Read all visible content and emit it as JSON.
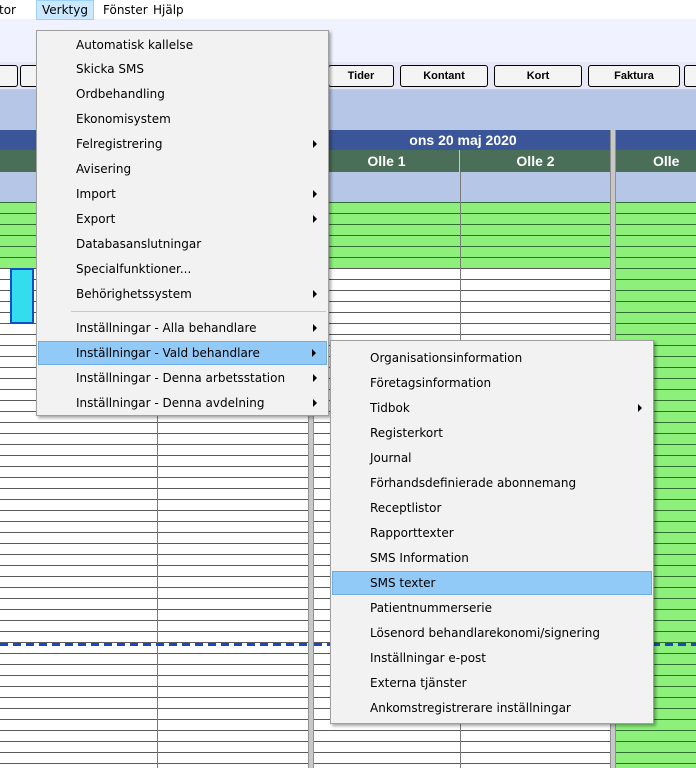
{
  "menubar": {
    "items": [
      {
        "label": "tor"
      },
      {
        "label": "Verktyg"
      },
      {
        "label": "Fönster"
      },
      {
        "label": "Hjälp"
      }
    ]
  },
  "toolbar": {
    "buttons": [
      {
        "label": ""
      },
      {
        "label": ""
      },
      {
        "label": "Tider"
      },
      {
        "label": "Kontant"
      },
      {
        "label": "Kort"
      },
      {
        "label": "Faktura"
      },
      {
        "label": ""
      }
    ]
  },
  "calendar": {
    "day1": {
      "date": "ons 20 maj 2020",
      "resources": [
        "Olle 1",
        "Olle 2"
      ]
    },
    "day2": {
      "date": "",
      "resources": [
        "Olle"
      ]
    },
    "colors": {
      "free_slot": "#8cf07a",
      "header": "#3a5698",
      "resource_header": "#4a6e58",
      "now_line": "#1848c8",
      "selected_booking": "#33ddee"
    }
  },
  "verktyg_menu": {
    "items": [
      {
        "label": "Automatisk kallelse"
      },
      {
        "label": "Skicka SMS"
      },
      {
        "label": "Ordbehandling"
      },
      {
        "label": "Ekonomisystem"
      },
      {
        "label": "Felregistrering"
      },
      {
        "label": "Avisering"
      },
      {
        "label": "Import"
      },
      {
        "label": "Export"
      },
      {
        "label": "Databasanslutningar"
      },
      {
        "label": "Specialfunktioner..."
      },
      {
        "label": "Behörighetssystem"
      },
      {
        "label": "Inställningar - Alla behandlare"
      },
      {
        "label": "Inställningar - Vald behandlare"
      },
      {
        "label": "Inställningar - Denna arbetsstation"
      },
      {
        "label": "Inställningar - Denna avdelning"
      }
    ],
    "highlighted": "Inställningar - Vald behandlare"
  },
  "submenu": {
    "items": [
      {
        "label": "Organisationsinformation"
      },
      {
        "label": "Företagsinformation"
      },
      {
        "label": "Tidbok"
      },
      {
        "label": "Registerkort"
      },
      {
        "label": "Journal"
      },
      {
        "label": "Förhandsdefinierade abonnemang"
      },
      {
        "label": "Receptlistor"
      },
      {
        "label": "Rapporttexter"
      },
      {
        "label": "SMS Information"
      },
      {
        "label": "SMS texter"
      },
      {
        "label": "Patientnummerserie"
      },
      {
        "label": "Lösenord behandlarekonomi/signering"
      },
      {
        "label": "Inställningar e-post"
      },
      {
        "label": "Externa tjänster"
      },
      {
        "label": "Ankomstregistrerare inställningar"
      }
    ],
    "highlighted": "SMS texter"
  }
}
